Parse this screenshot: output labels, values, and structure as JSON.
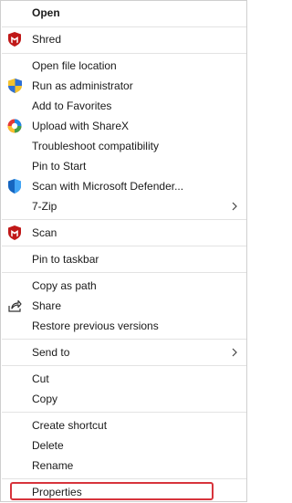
{
  "menu": {
    "items": {
      "open": {
        "label": "Open"
      },
      "shred": {
        "label": "Shred",
        "icon": "mcafee-shield-icon"
      },
      "open_file_location": {
        "label": "Open file location"
      },
      "run_as_admin": {
        "label": "Run as administrator",
        "icon": "uac-shield-icon"
      },
      "add_favorites": {
        "label": "Add to Favorites"
      },
      "sharex": {
        "label": "Upload with ShareX",
        "icon": "sharex-icon"
      },
      "troubleshoot": {
        "label": "Troubleshoot compatibility"
      },
      "pin_start": {
        "label": "Pin to Start"
      },
      "defender": {
        "label": "Scan with Microsoft Defender...",
        "icon": "defender-shield-icon"
      },
      "sevenzip": {
        "label": "7-Zip",
        "has_submenu": true
      },
      "scan": {
        "label": "Scan",
        "icon": "mcafee-shield-icon"
      },
      "pin_taskbar": {
        "label": "Pin to taskbar"
      },
      "copy_path": {
        "label": "Copy as path"
      },
      "share": {
        "label": "Share",
        "icon": "share-icon"
      },
      "restore_versions": {
        "label": "Restore previous versions"
      },
      "send_to": {
        "label": "Send to",
        "has_submenu": true
      },
      "cut": {
        "label": "Cut"
      },
      "copy": {
        "label": "Copy"
      },
      "create_shortcut": {
        "label": "Create shortcut"
      },
      "delete": {
        "label": "Delete"
      },
      "rename": {
        "label": "Rename"
      },
      "properties": {
        "label": "Properties",
        "highlighted": true
      }
    }
  },
  "colors": {
    "highlight_border": "#d7343c",
    "mcafee_red": "#c01818",
    "separator": "#e3e3e3"
  }
}
